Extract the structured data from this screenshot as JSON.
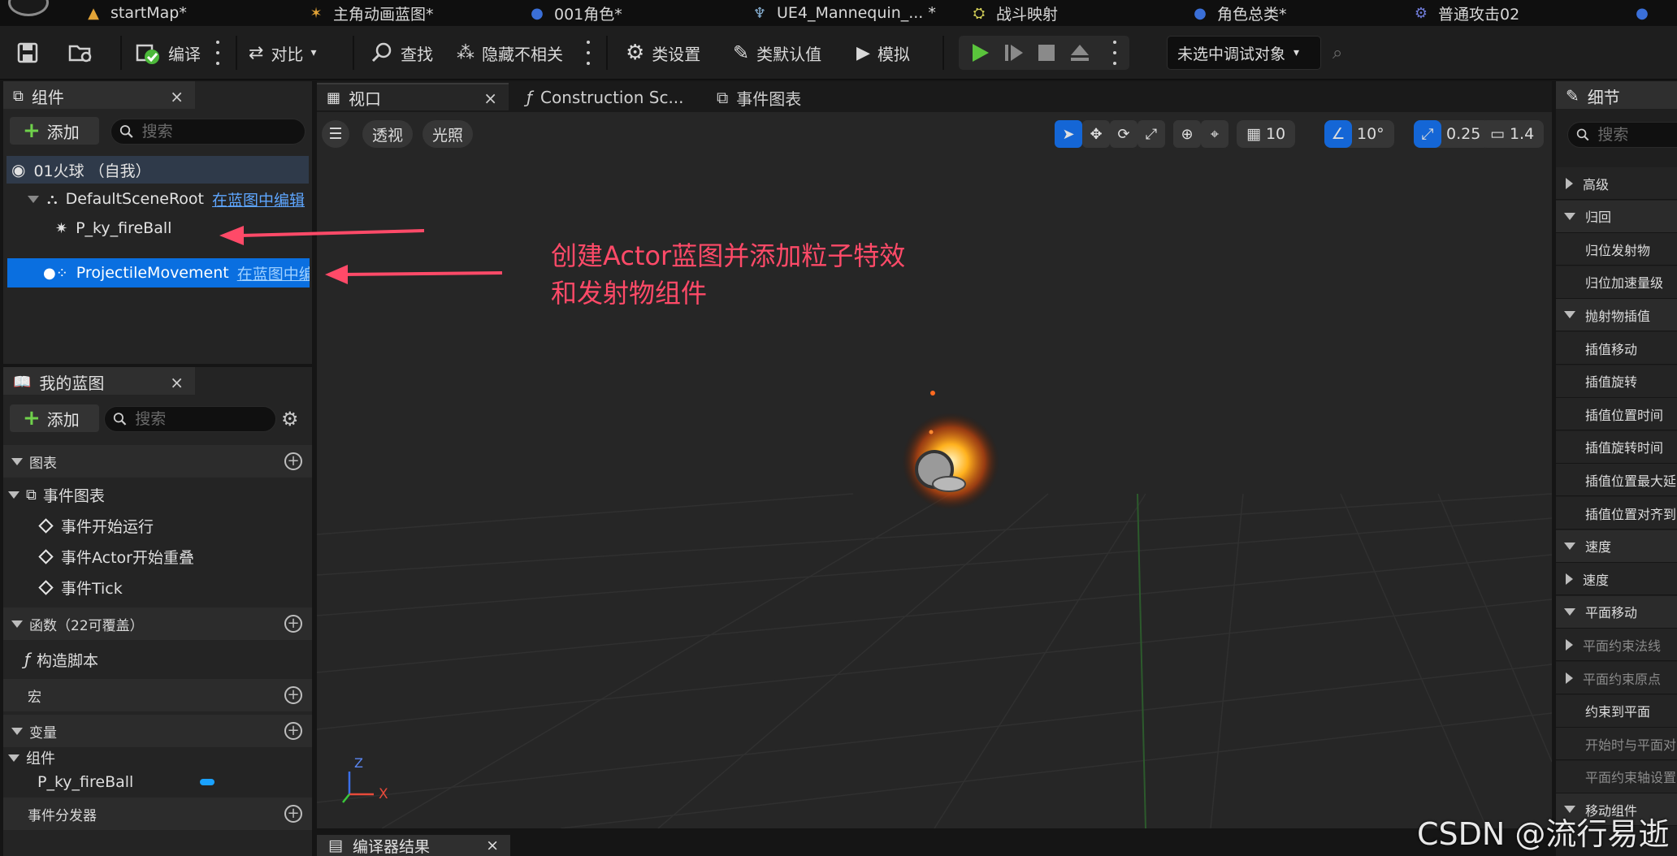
{
  "asset_tabs": [
    {
      "label": "startMap*",
      "icon": "map-icon"
    },
    {
      "label": "主角动画蓝图*",
      "icon": "anim-blueprint-icon"
    },
    {
      "label": "001角色*",
      "icon": "character-icon"
    },
    {
      "label": "UE4_Mannequin_... *",
      "icon": "skeleton-icon"
    },
    {
      "label": "战斗映射",
      "icon": "input-mapping-icon"
    },
    {
      "label": "角色总类*",
      "icon": "character-icon"
    },
    {
      "label": "普通攻击02",
      "icon": "montage-icon"
    }
  ],
  "toolbar": {
    "compile": "编译",
    "diff": "对比",
    "find": "查找",
    "hide_unrelated": "隐藏不相关",
    "class_settings": "类设置",
    "class_defaults": "类默认值",
    "simulate": "模拟",
    "debug_target": "未选中调试对象"
  },
  "components_panel": {
    "title": "组件",
    "add_label": "添加",
    "search_placeholder": "搜索",
    "self_item": "01火球 （自我）",
    "items": [
      {
        "name": "DefaultSceneRoot",
        "link": "在蓝图中编辑"
      },
      {
        "name": "P_ky_fireBall",
        "link": ""
      },
      {
        "name": "ProjectileMovement",
        "link": "在蓝图中编"
      }
    ]
  },
  "my_blueprint": {
    "title": "我的蓝图",
    "add_label": "添加",
    "search_placeholder": "搜索",
    "sections": {
      "graphs": "图表",
      "event_graph": "事件图表",
      "events": [
        "事件开始运行",
        "事件Actor开始重叠",
        "事件Tick"
      ],
      "functions": "函数（22可覆盖）",
      "construction_script": "构造脚本",
      "macros": "宏",
      "variables": "变量",
      "components": "组件",
      "component_var": "P_ky_fireBall",
      "dispatchers": "事件分发器"
    }
  },
  "editor_tabs": [
    {
      "label": "视口",
      "active": true
    },
    {
      "label": "Construction Sc...",
      "active": false
    },
    {
      "label": "事件图表",
      "active": false
    }
  ],
  "viewport": {
    "perspective": "透视",
    "lighting": "光照",
    "grid_snap": "10",
    "rotation_snap": "10°",
    "scale_snap": "0.25",
    "camera_speed": "1.4",
    "axis_x": "X",
    "axis_z": "Z"
  },
  "annotation": {
    "line1": "创建Actor蓝图并添加粒子特效",
    "line2": "和发射物组件",
    "color": "#ff4a68"
  },
  "details": {
    "title": "细节",
    "search_placeholder": "搜索",
    "rows": [
      {
        "label": "高级",
        "kind": "sub"
      },
      {
        "label": "归回",
        "kind": "cat"
      },
      {
        "label": "归位发射物",
        "kind": "prop"
      },
      {
        "label": "归位加速量级",
        "kind": "prop"
      },
      {
        "label": "抛射物插值",
        "kind": "cat"
      },
      {
        "label": "插值移动",
        "kind": "prop"
      },
      {
        "label": "插值旋转",
        "kind": "prop"
      },
      {
        "label": "插值位置时间",
        "kind": "prop"
      },
      {
        "label": "插值旋转时间",
        "kind": "prop"
      },
      {
        "label": "插值位置最大延",
        "kind": "prop"
      },
      {
        "label": "插值位置对齐到",
        "kind": "prop"
      },
      {
        "label": "速度",
        "kind": "cat"
      },
      {
        "label": "速度",
        "kind": "sub"
      },
      {
        "label": "平面移动",
        "kind": "cat"
      },
      {
        "label": "平面约束法线",
        "kind": "subdim"
      },
      {
        "label": "平面约束原点",
        "kind": "subdim"
      },
      {
        "label": "约束到平面",
        "kind": "prop"
      },
      {
        "label": "开始时与平面对",
        "kind": "propdim"
      },
      {
        "label": "平面约束轴设置",
        "kind": "propdim"
      },
      {
        "label": "移动组件",
        "kind": "cat"
      }
    ]
  },
  "bottom": {
    "compiler_results": "编译器结果",
    "watermark": "CSDN @流行易逝"
  },
  "colors": {
    "accent_blue": "#1466d6",
    "selection": "#0a6fe0",
    "play_green": "#5ac43c",
    "annotation": "#ff4a68"
  }
}
